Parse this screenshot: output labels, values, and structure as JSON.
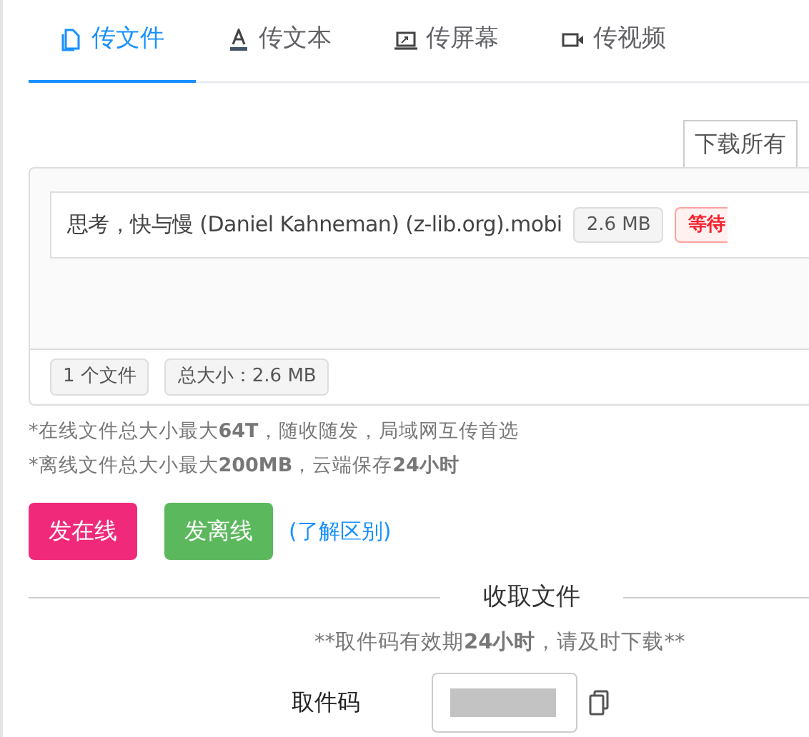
{
  "tabs": [
    {
      "label": "传文件",
      "selected": true
    },
    {
      "label": "传文本",
      "selected": false
    },
    {
      "label": "传屏幕",
      "selected": false
    },
    {
      "label": "传视频",
      "selected": false
    }
  ],
  "toolbar": {
    "download_all": "下载所有"
  },
  "files": [
    {
      "name": "思考，快与慢 (Daniel Kahneman) (z-lib.org).mobi",
      "size": "2.6 MB",
      "status": "等待"
    }
  ],
  "summary": {
    "count": "1 个文件",
    "total": "总大小：2.6 MB"
  },
  "notes": [
    [
      {
        "text": "*在线文件总大小最大",
        "bold": false
      },
      {
        "text": "64T",
        "bold": true
      },
      {
        "text": "，随收随发，局域网互传首选",
        "bold": false
      }
    ],
    [
      {
        "text": "*离线文件总大小最大",
        "bold": false
      },
      {
        "text": "200MB",
        "bold": true
      },
      {
        "text": "，云端保存",
        "bold": false
      },
      {
        "text": "24小时",
        "bold": true
      }
    ]
  ],
  "actions": {
    "online": "发在线",
    "offline": "发离线",
    "learn": "(了解区别)"
  },
  "receive": {
    "title": "收取文件",
    "notice": [
      {
        "text": "**取件码有效期",
        "bold": false
      },
      {
        "text": "24小时",
        "bold": true
      },
      {
        "text": "，请及时下载**",
        "bold": false
      }
    ],
    "code_label": "取件码"
  }
}
